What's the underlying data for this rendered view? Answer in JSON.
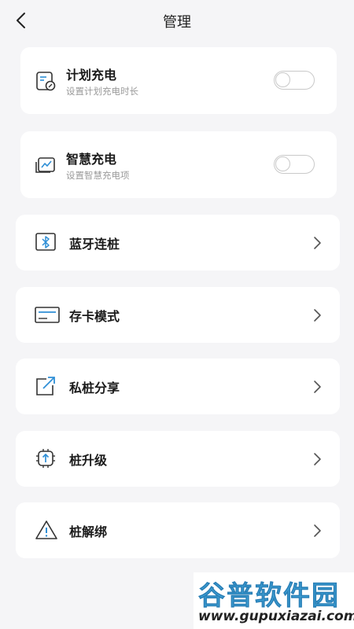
{
  "header": {
    "title": "管理",
    "back_icon": "back-chevron-icon"
  },
  "colors": {
    "background": "#f5f5f7",
    "card": "#ffffff",
    "accent_blue": "#2f8fd6",
    "icon_dark": "#333333"
  },
  "toggles": [
    {
      "label": "计划充电",
      "subtitle": "设置计划充电时长",
      "icon": "schedule-charge-icon",
      "on": false
    },
    {
      "label": "智慧充电",
      "subtitle": "设置智慧充电项",
      "icon": "smart-charge-icon",
      "on": false
    }
  ],
  "menu": [
    {
      "label": "蓝牙连桩",
      "icon": "bluetooth-icon"
    },
    {
      "label": "存卡模式",
      "icon": "card-icon"
    },
    {
      "label": "私桩分享",
      "icon": "share-icon"
    },
    {
      "label": "桩升级",
      "icon": "upgrade-icon"
    },
    {
      "label": "桩解绑",
      "icon": "warning-icon"
    }
  ],
  "watermark": {
    "name": "谷普软件园",
    "url": "www.gupuxiazai.com"
  }
}
